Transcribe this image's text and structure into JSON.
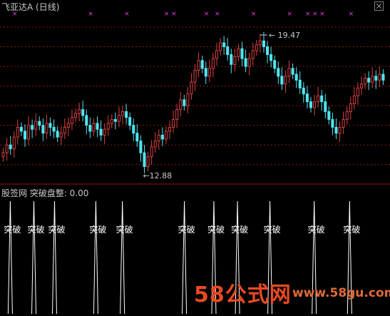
{
  "window": {
    "title": "飞亚达A (日线)"
  },
  "indicator_panel": {
    "label": "股签网 突破盘整: 0.00",
    "signal_text": "突破"
  },
  "watermark": {
    "logo": "58公式网",
    "url": "www.58gu.com"
  },
  "colors": {
    "up": "#d94040",
    "down": "#4fe6f0",
    "grid": "#8b1a1a",
    "marker": "#e040e0",
    "signal": "#ffffff"
  },
  "chart_data": [
    {
      "type": "candlestick",
      "title": "飞亚达A (日线)",
      "high_annotation": "19.47",
      "low_annotation": "12.88",
      "ylim": [
        12.3,
        20.8
      ],
      "grid_levels": [
        13,
        14,
        15,
        16,
        17,
        18,
        19,
        20
      ],
      "close": [
        13.6,
        14.0,
        13.8,
        14.4,
        14.9,
        14.7,
        14.3,
        15.0,
        14.8,
        15.2,
        15.0,
        14.6,
        15.1,
        14.9,
        14.7,
        14.4,
        14.6,
        14.9,
        15.1,
        15.4,
        15.6,
        15.8,
        15.5,
        15.0,
        14.7,
        15.1,
        14.8,
        14.5,
        14.8,
        15.1,
        15.3,
        15.2,
        15.5,
        15.7,
        15.4,
        15.0,
        14.6,
        14.2,
        13.6,
        12.9,
        13.4,
        13.9,
        14.2,
        14.5,
        14.3,
        14.7,
        14.9,
        15.3,
        15.8,
        16.3,
        16.0,
        16.6,
        17.2,
        17.8,
        18.3,
        17.9,
        17.5,
        17.9,
        18.4,
        18.8,
        19.2,
        19.0,
        18.6,
        18.1,
        18.5,
        18.9,
        18.4,
        18.0,
        18.4,
        18.8,
        19.1,
        19.3,
        19.0,
        18.6,
        18.3,
        17.9,
        17.5,
        17.1,
        17.5,
        17.9,
        17.6,
        17.3,
        16.9,
        16.6,
        16.2,
        15.9,
        16.2,
        16.5,
        16.2,
        15.7,
        15.3,
        14.9,
        14.6,
        14.9,
        15.3,
        15.7,
        16.1,
        16.5,
        16.9,
        17.1,
        17.4,
        17.2,
        17.5,
        17.3,
        17.6,
        17.3
      ],
      "markers_top_indices": [
        3,
        24,
        34,
        45,
        47,
        56,
        59,
        69,
        79,
        84,
        86,
        88,
        96
      ],
      "y_axis": "price",
      "x_axis": "trading day"
    },
    {
      "type": "line",
      "title": "突破盘整",
      "value": 0.0,
      "signal_indices": [
        3,
        11,
        18,
        32,
        41,
        62,
        72,
        80,
        91,
        106,
        118
      ],
      "signal_label": "突破"
    }
  ]
}
